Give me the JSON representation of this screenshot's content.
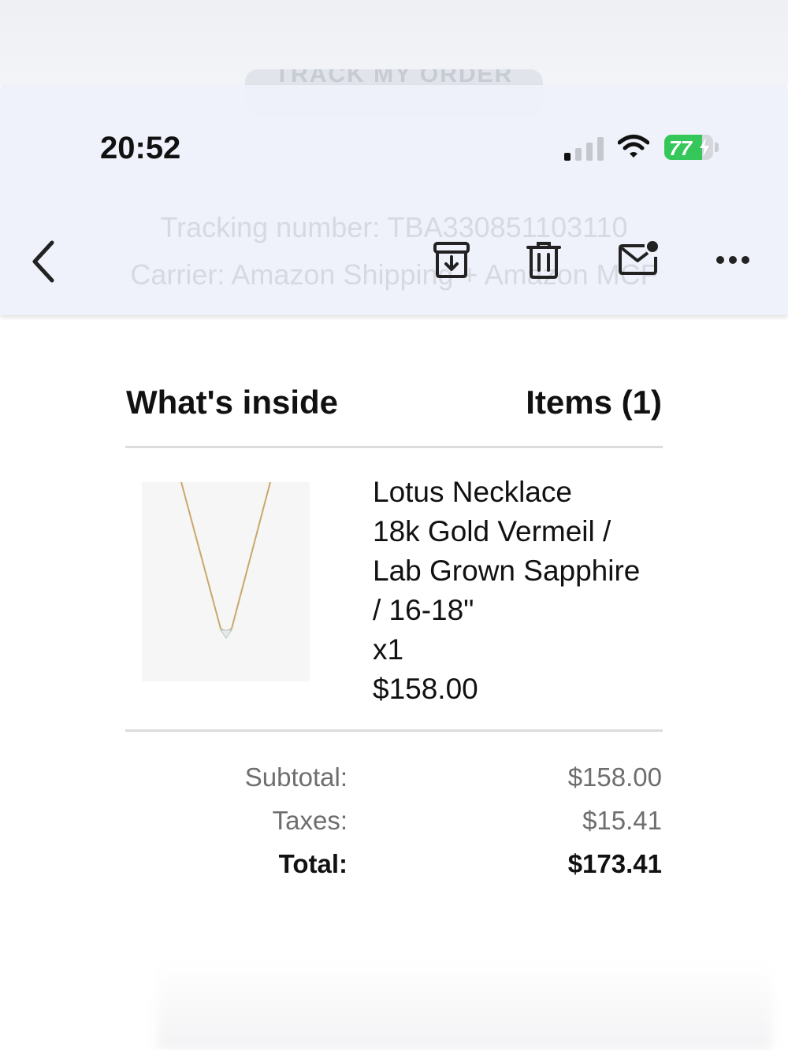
{
  "status_bar": {
    "time": "20:52",
    "battery_level": "77",
    "battery_color": "#35c759",
    "icons": [
      "signal-icon",
      "wifi-icon",
      "charging-battery-icon"
    ]
  },
  "background": {
    "ghost_button": "TRACK MY ORDER",
    "tracking_line": "Tracking number: TBA330851103110",
    "carrier_line": "Carrier: Amazon Shipping + Amazon MCF"
  },
  "toolbar": {
    "icons": [
      "back-chevron-icon",
      "archive-icon",
      "trash-icon",
      "mark-unread-icon",
      "more-icon"
    ]
  },
  "order": {
    "section_title": "What's inside",
    "items_count": "Items (1)",
    "item": {
      "name": "Lotus Necklace",
      "variant_line1": "18k Gold Vermeil /",
      "variant_line2": "Lab Grown Sapphire",
      "variant_line3": "/ 16-18\"",
      "quantity": "x1",
      "price": "$158.00"
    },
    "summary": {
      "subtotal_label": "Subtotal:",
      "subtotal_value": "$158.00",
      "taxes_label": "Taxes:",
      "taxes_value": "$15.41",
      "total_label": "Total:",
      "total_value": "$173.41"
    }
  }
}
